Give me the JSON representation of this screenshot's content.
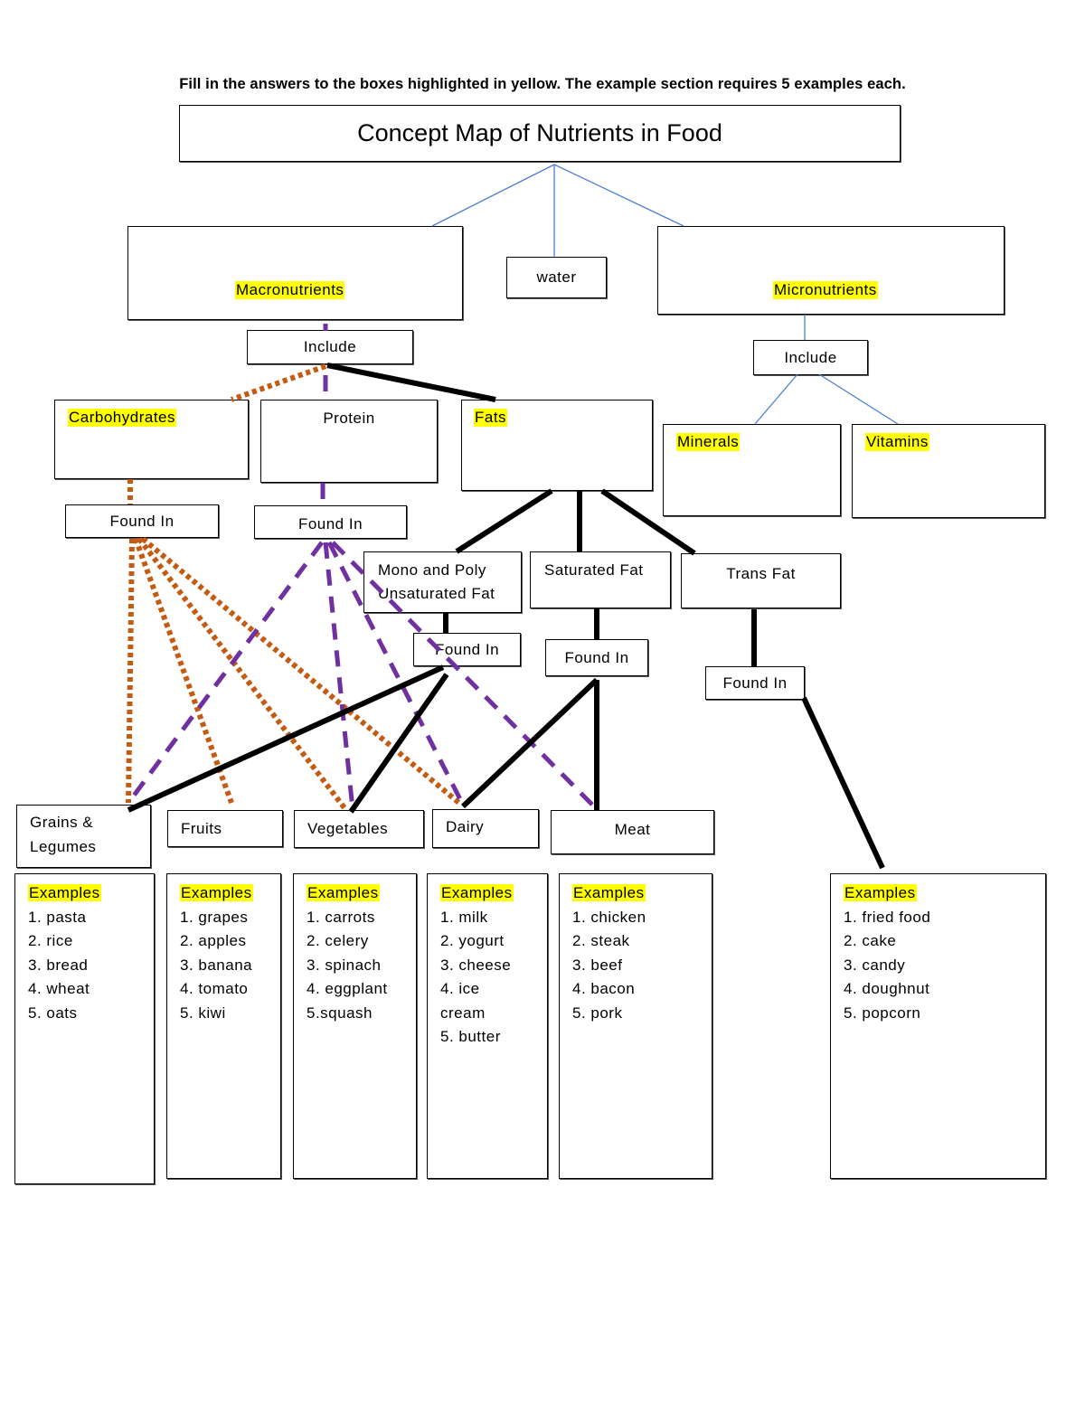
{
  "instructions": "Fill in the answers to the boxes highlighted in yellow. The example section requires 5 examples each.",
  "title": "Concept Map of Nutrients in Food",
  "colors": {
    "highlight": "#ffff00",
    "blue_connector": "#4a7fd4",
    "carb_connector": "#c55a11",
    "protein_connector": "#7030a0",
    "fat_connector": "#000000"
  },
  "level1": {
    "macronutrients": "Macronutrients",
    "water": "water",
    "micronutrients": "Micronutrients"
  },
  "include_macro": "Include",
  "include_micro": "Include",
  "macro": {
    "carbohydrates": "Carbohydrates",
    "protein": "Protein",
    "fats": "Fats"
  },
  "micro": {
    "minerals": "Minerals",
    "vitamins": "Vitamins"
  },
  "found_in": {
    "carbs": "Found In",
    "protein": "Found In",
    "unsaturated": "Found In",
    "saturated": "Found In",
    "trans": "Found In"
  },
  "fat_types": {
    "unsaturated_line1": "Mono and Poly",
    "unsaturated_line2": "Unsaturated Fat",
    "saturated": "Saturated Fat",
    "trans": "Trans Fat"
  },
  "food_groups": {
    "grains_line1": "Grains &",
    "grains_line2": "Legumes",
    "fruits": "Fruits",
    "vegetables": "Vegetables",
    "dairy": "Dairy",
    "meat": "Meat"
  },
  "examples": [
    {
      "id": "grains",
      "heading": "Examples",
      "items": [
        "1. pasta",
        "2. rice",
        "3. bread",
        "4. wheat",
        "5. oats"
      ]
    },
    {
      "id": "fruits",
      "heading": "Examples",
      "items": [
        "1. grapes",
        "2. apples",
        "3. banana",
        "4. tomato",
        "5. kiwi"
      ]
    },
    {
      "id": "vegetables",
      "heading": "Examples",
      "items": [
        "1. carrots",
        "2. celery",
        "3. spinach",
        "4. eggplant",
        "5.squash"
      ]
    },
    {
      "id": "dairy",
      "heading": "Examples",
      "items": [
        "1. milk",
        "2. yogurt",
        "3. cheese",
        "4. ice",
        "cream",
        "5. butter"
      ]
    },
    {
      "id": "meat",
      "heading": "Examples",
      "items": [
        "1. chicken",
        "2. steak",
        "3. beef",
        "4. bacon",
        "5. pork"
      ]
    },
    {
      "id": "trans",
      "heading": "Examples",
      "items": [
        "1. fried food",
        "2. cake",
        "3. candy",
        "4. doughnut",
        "5. popcorn"
      ]
    }
  ]
}
